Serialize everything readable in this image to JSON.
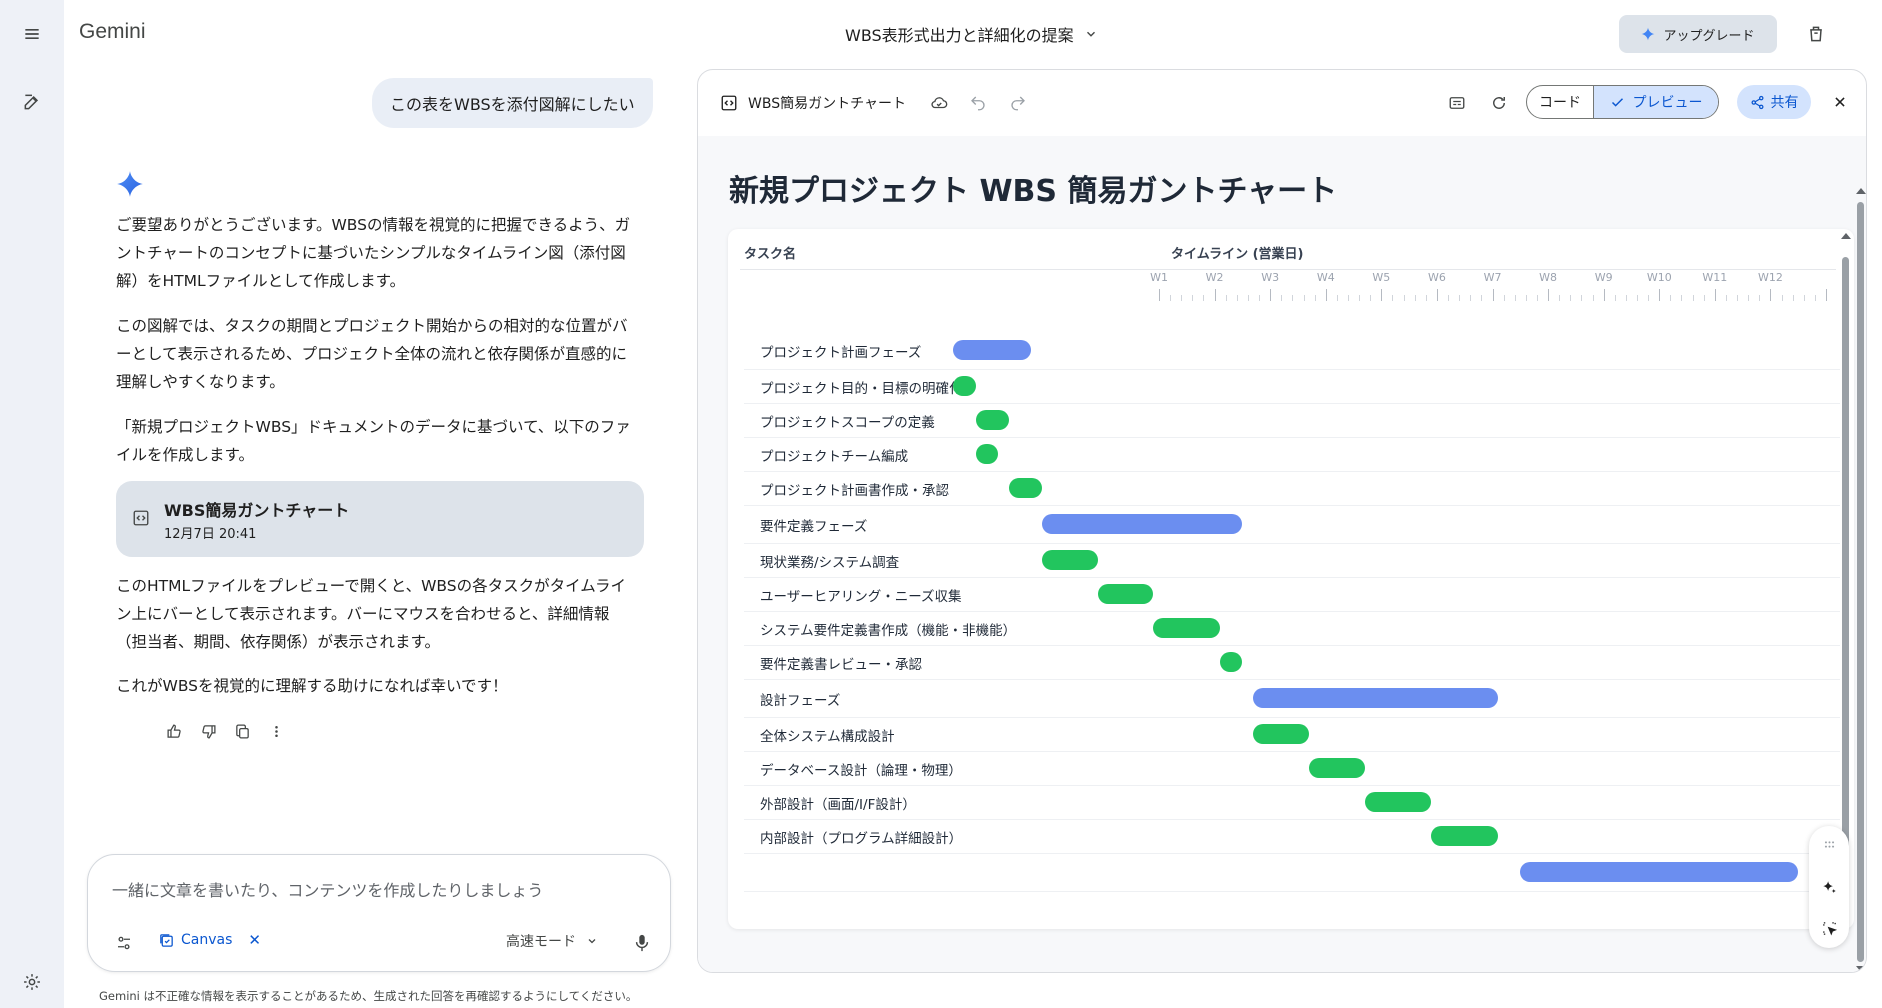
{
  "app": {
    "brand": "Gemini"
  },
  "header": {
    "conversation_title": "WBS表形式出力と詳細化の提案",
    "upgrade_label": "アップグレード"
  },
  "chat": {
    "user_message": "この表をWBSを添付図解にしたい",
    "paragraphs": [
      [
        "ご要望ありがとうございます。WBSの情報を視覚的に把握できるよう、ガ",
        "ントチャートのコンセプトに基づいたシンプルなタイムライン図（添付図",
        "解）をHTMLファイルとして作成します。"
      ],
      [
        "この図解では、タスクの期間とプロジェクト開始からの相対的な位置がバ",
        "ーとして表示されるため、プロジェクト全体の流れと依存関係が直感的に",
        "理解しやすくなります。"
      ],
      [
        "「新規プロジェクトWBS」ドキュメントのデータに基づいて、以下のファ",
        "イルを作成します。"
      ]
    ],
    "file_card": {
      "title": "WBS簡易ガントチャート",
      "date": "12月7日 20:41"
    },
    "paragraphs_after": [
      [
        "このHTMLファイルをプレビューで開くと、WBSの各タスクがタイムライ",
        "ン上にバーとして表示されます。バーにマウスを合わせると、詳細情報",
        "（担当者、期間、依存関係）が表示されます。"
      ],
      [
        "これがWBSを視覚的に理解する助けになれば幸いです！"
      ]
    ]
  },
  "input": {
    "placeholder": "一緒に文章を書いたり、コンテンツを作成したりしましょう",
    "canvas_chip": "Canvas",
    "mode": "高速モード"
  },
  "disclaimer": "Gemini は不正確な情報を表示することがあるため、生成された回答を再確認するようにしてください。",
  "panel": {
    "title": "WBS簡易ガントチャート",
    "code_label": "コード",
    "preview_label": "プレビュー",
    "share_label": "共有"
  },
  "gantt": {
    "title": "新規プロジェクト WBS 簡易ガントチャート",
    "task_header": "タスク名",
    "timeline_header": "タイムライン (営業日)",
    "weeks": [
      "W1",
      "W2",
      "W3",
      "W4",
      "W5",
      "W6",
      "W7",
      "W8",
      "W9",
      "W10",
      "W11",
      "W12"
    ],
    "total_weeks": 12,
    "rows": [
      {
        "label": "プロジェクト計画フェーズ",
        "kind": "phase",
        "start": -3.7,
        "end": -2.3
      },
      {
        "label": "プロジェクト目的・目標の明確化",
        "kind": "task",
        "start": -3.7,
        "end": -3.3
      },
      {
        "label": "プロジェクトスコープの定義",
        "kind": "task",
        "start": -3.3,
        "end": -2.7
      },
      {
        "label": "プロジェクトチーム編成",
        "kind": "task",
        "start": -3.3,
        "end": -2.9
      },
      {
        "label": "プロジェクト計画書作成・承認",
        "kind": "task",
        "start": -2.7,
        "end": -2.1
      },
      {
        "label": "要件定義フェーズ",
        "kind": "phase",
        "start": -2.1,
        "end": 1.5
      },
      {
        "label": "現状業務/システム調査",
        "kind": "task",
        "start": -2.1,
        "end": -1.1
      },
      {
        "label": "ユーザーヒアリング・ニーズ収集",
        "kind": "task",
        "start": -1.1,
        "end": -0.1
      },
      {
        "label": "システム要件定義書作成（機能・非機能）",
        "kind": "task",
        "start": -0.1,
        "end": 1.1
      },
      {
        "label": "要件定義書レビュー・承認",
        "kind": "task",
        "start": 1.1,
        "end": 1.5
      },
      {
        "label": "設計フェーズ",
        "kind": "phase",
        "start": 1.7,
        "end": 6.1
      },
      {
        "label": "全体システム構成設計",
        "kind": "task",
        "start": 1.7,
        "end": 2.7
      },
      {
        "label": "データベース設計（論理・物理）",
        "kind": "task",
        "start": 2.7,
        "end": 3.7
      },
      {
        "label": "外部設計（画面/I/F設計）",
        "kind": "task",
        "start": 3.7,
        "end": 4.9
      },
      {
        "label": "内部設計（プログラム詳細設計）",
        "kind": "task",
        "start": 4.9,
        "end": 6.1
      },
      {
        "label": "",
        "kind": "phase",
        "start": 6.5,
        "end": 11.5
      }
    ]
  }
}
